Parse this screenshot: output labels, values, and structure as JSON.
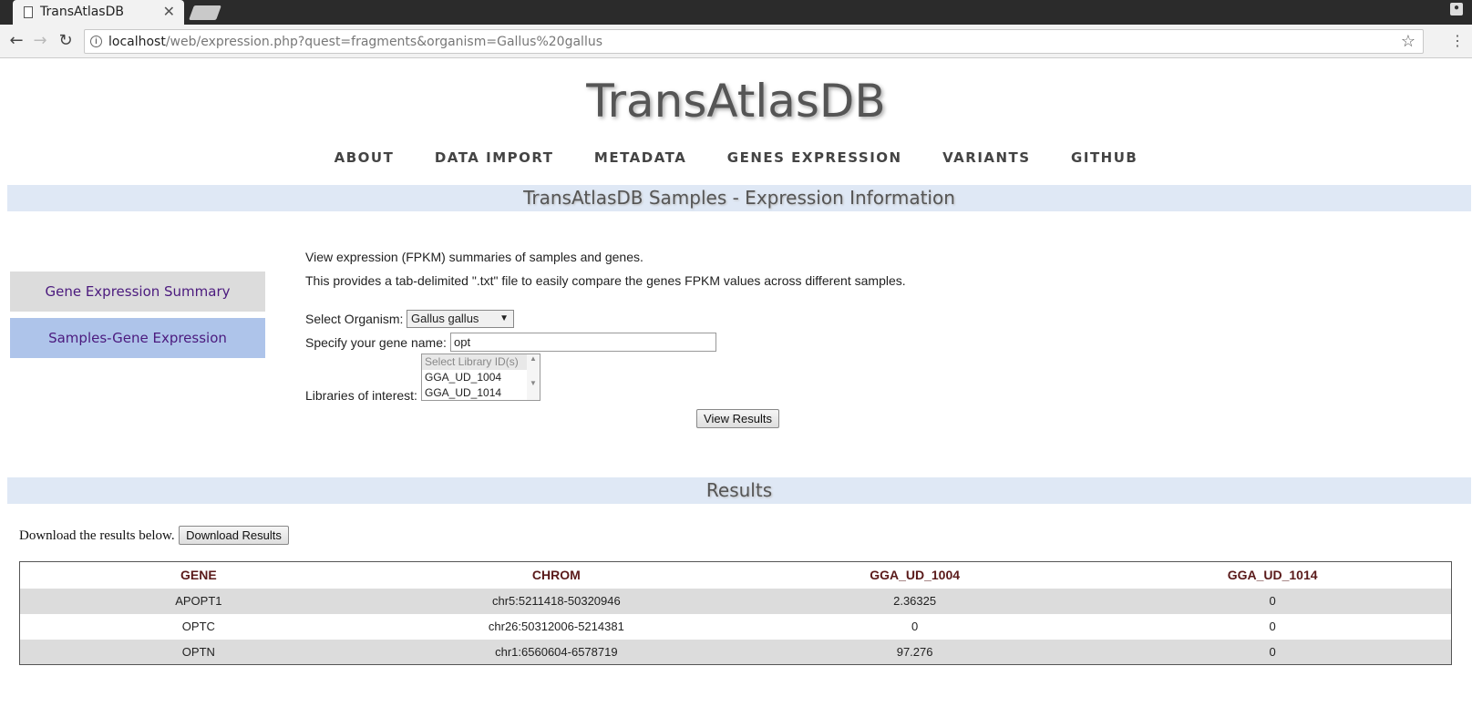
{
  "browser": {
    "tab_title": "TransAtlasDB",
    "tab_close": "✕",
    "url_host": "localhost",
    "url_path": "/web/expression.php?quest=fragments&organism=Gallus%20gallus"
  },
  "site": {
    "title": "TransAtlasDB",
    "nav": [
      "ABOUT",
      "DATA IMPORT",
      "METADATA",
      "GENES EXPRESSION",
      "VARIANTS",
      "GITHUB"
    ],
    "section_title": "TransAtlasDB Samples - Expression Information"
  },
  "sidebar": {
    "items": [
      {
        "label": "Gene Expression Summary",
        "active": false
      },
      {
        "label": "Samples-Gene Expression",
        "active": true
      }
    ]
  },
  "content": {
    "desc1": "View expression (FPKM) summaries of samples and genes.",
    "desc2": "This provides a tab-delimited \".txt\" file to easily compare the genes FPKM values across different samples.",
    "organism_label": "Select Organism:",
    "organism_value": "Gallus gallus",
    "gene_label": "Specify your gene name:",
    "gene_value": "opt",
    "libraries_label": "Libraries of interest:",
    "libraries": [
      "Select Library ID(s)",
      "GGA_UD_1004",
      "GGA_UD_1014"
    ],
    "view_button": "View Results"
  },
  "results": {
    "title": "Results",
    "download_text": "Download the results below.",
    "download_button": "Download Results",
    "columns": [
      "GENE",
      "CHROM",
      "GGA_UD_1004",
      "GGA_UD_1014"
    ],
    "rows": [
      [
        "APOPT1",
        "chr5:5211418-50320946",
        "2.36325",
        "0"
      ],
      [
        "OPTC",
        "chr26:50312006-5214381",
        "0",
        "0"
      ],
      [
        "OPTN",
        "chr1:6560604-6578719",
        "97.276",
        "0"
      ]
    ]
  }
}
